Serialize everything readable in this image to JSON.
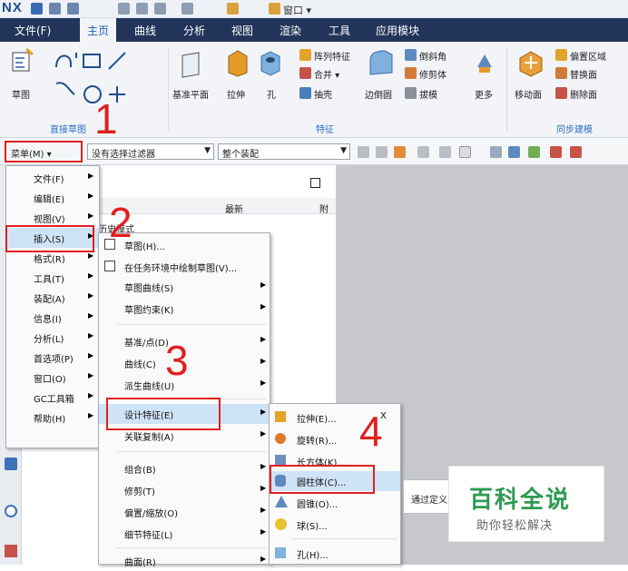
{
  "app": {
    "logo": "NX",
    "window_menu": "窗口 ▾"
  },
  "ribbon_tabs": [
    "文件(F)",
    "主页",
    "曲线",
    "分析",
    "视图",
    "渲染",
    "工具",
    "应用模块"
  ],
  "ribbon": {
    "sketch": "草图",
    "group_direct_sketch": "直接草图",
    "datum_plane": "基准平面",
    "extrude": "拉伸",
    "hole": "孔",
    "pattern_feature": "阵列特征",
    "unite": "合并 ▾",
    "shell": "抽壳",
    "edge_blend": "边倒圆",
    "chamfer": "倒斜角",
    "trim_body": "修剪体",
    "draft": "拔模",
    "more": "更多",
    "group_feature": "特征",
    "move_face": "移动面",
    "offset_region": "偏置区域",
    "replace_face": "替换面",
    "delete_face": "删除面",
    "group_sync": "同步建模"
  },
  "selbar": {
    "menu_button": "菜单(M) ▾",
    "filter": "没有选择过滤器",
    "scope": "整个装配"
  },
  "nav_panel": {
    "col_latest": "最新",
    "col_extra": "附",
    "row_prefix": "历史模式"
  },
  "main_menu": [
    "文件(F)",
    "编辑(E)",
    "视图(V)",
    "插入(S)",
    "格式(R)",
    "工具(T)",
    "装配(A)",
    "信息(I)",
    "分析(L)",
    "首选项(P)",
    "窗口(O)",
    "GC工具箱",
    "帮助(H)"
  ],
  "insert_menu": [
    "草图(H)...",
    "在任务环境中绘制草图(V)...",
    "草图曲线(S)",
    "草图约束(K)",
    "基准/点(D)",
    "曲线(C)",
    "派生曲线(U)",
    "设计特征(E)",
    "关联复制(A)",
    "组合(B)",
    "修剪(T)",
    "偏置/缩放(O)",
    "细节特征(L)",
    "曲面(R)"
  ],
  "design_feature_menu": [
    "拉伸(E)...",
    "旋转(R)...",
    "长方体(K)...",
    "圆柱体(C)...",
    "圆锥(O)...",
    "球(S)...",
    "孔(H)..."
  ],
  "tooltip_partial": "通过定义",
  "shortcut_partial": "X",
  "steps": [
    "1",
    "2",
    "3",
    "4"
  ],
  "watermark": {
    "title": "百科全说",
    "subtitle": "助你轻松解决"
  },
  "colors": {
    "annotation_red": "#e02020",
    "ribbon_dark": "#22345a",
    "watermark_green": "#2e9a52"
  }
}
